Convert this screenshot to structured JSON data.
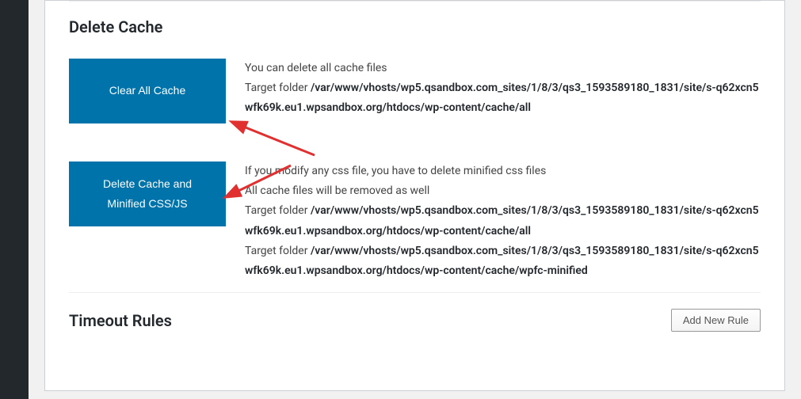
{
  "sections": {
    "deleteCache": {
      "title": "Delete Cache",
      "clearAll": {
        "buttonLabel": "Clear All Cache",
        "descLine": "You can delete all cache files",
        "targetLabel": "Target folder",
        "targetPath": "/var/www/vhosts/wp5.qsandbox.com_sites/1/8/3/qs3_1593589180_1831/site/s-q62xcn5wfk69k.eu1.wpsandbox.org/htdocs/wp-content/cache/all"
      },
      "deleteMinified": {
        "buttonLine1": "Delete Cache and",
        "buttonLine2": "Minified CSS/JS",
        "descLine1": "If you modify any css file, you have to delete minified css files",
        "descLine2": "All cache files will be removed as well",
        "targetLabel1": "Target folder",
        "targetPath1": "/var/www/vhosts/wp5.qsandbox.com_sites/1/8/3/qs3_1593589180_1831/site/s-q62xcn5wfk69k.eu1.wpsandbox.org/htdocs/wp-content/cache/all",
        "targetLabel2": "Target folder",
        "targetPath2": "/var/www/vhosts/wp5.qsandbox.com_sites/1/8/3/qs3_1593589180_1831/site/s-q62xcn5wfk69k.eu1.wpsandbox.org/htdocs/wp-content/cache/wpfc-minified"
      }
    },
    "timeoutRules": {
      "title": "Timeout Rules",
      "addButtonLabel": "Add New Rule"
    }
  }
}
